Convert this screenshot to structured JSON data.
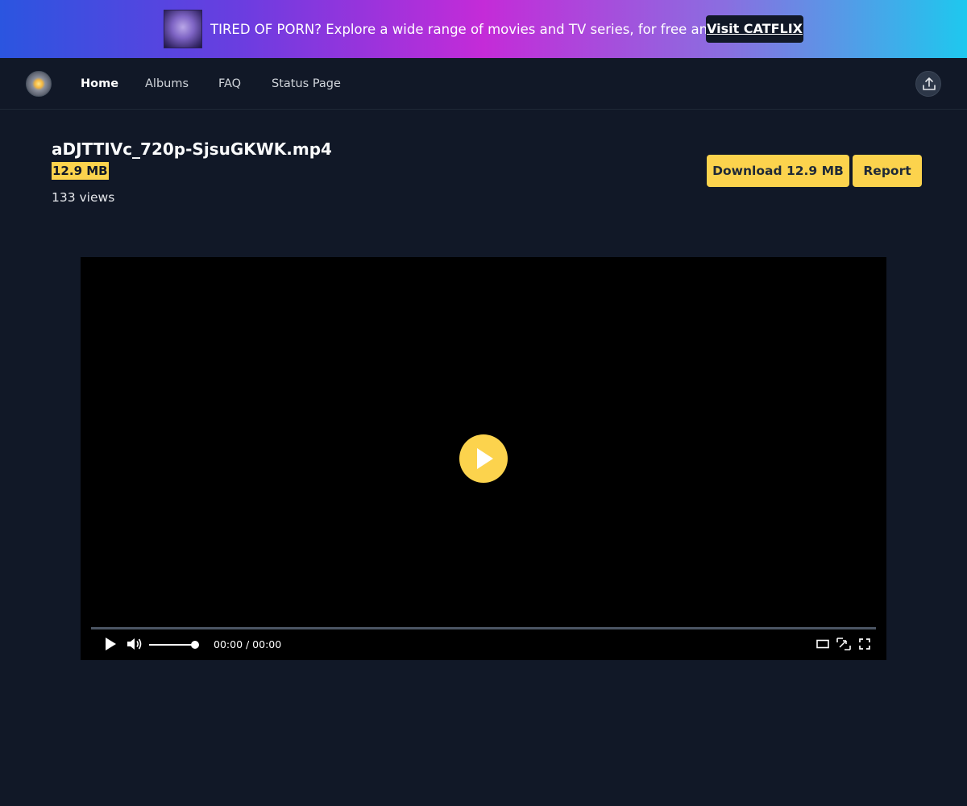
{
  "banner": {
    "text": "TIRED OF PORN? Explore a wide range of movies and TV series, for free and no ads.",
    "button_label": "Visit CATFLIX"
  },
  "nav": {
    "items": [
      {
        "label": "Home",
        "active": true
      },
      {
        "label": "Albums",
        "active": false
      },
      {
        "label": "FAQ",
        "active": false
      },
      {
        "label": "Status Page",
        "active": false
      }
    ],
    "upload_icon": "upload-icon"
  },
  "file": {
    "name": "aDJTTIVc_720p-SjsuGKWK.mp4",
    "size": "12.9 MB",
    "views": "133 views"
  },
  "actions": {
    "download_label": "Download 12.9 MB",
    "report_label": "Report"
  },
  "player": {
    "time": "00:00 / 00:00",
    "volume_level": 1.0,
    "progress": 0
  },
  "colors": {
    "accent": "#fcd34d",
    "background": "#111827"
  }
}
